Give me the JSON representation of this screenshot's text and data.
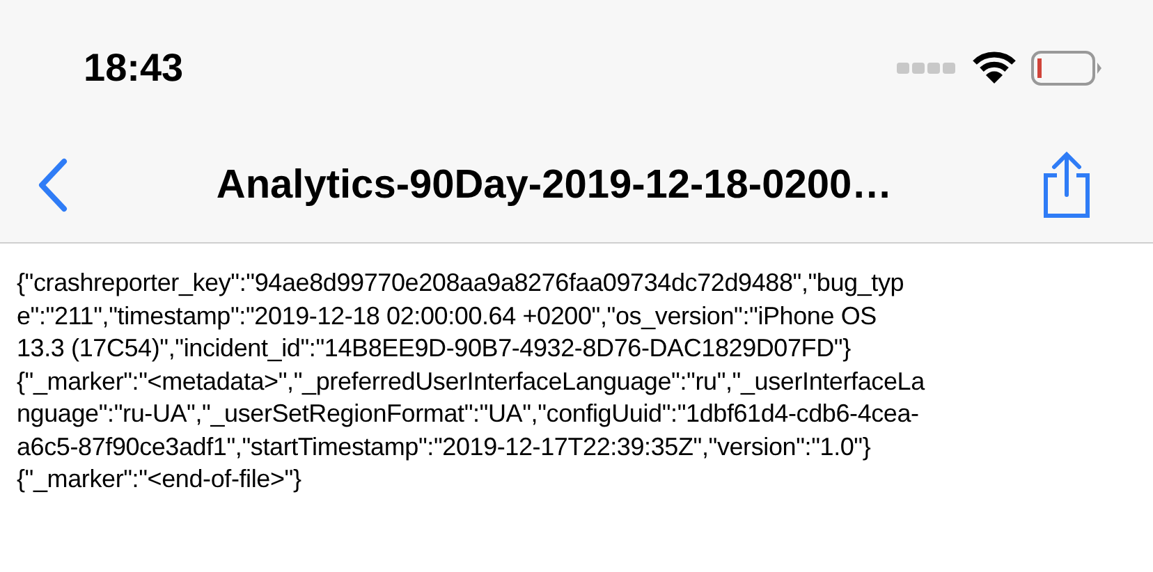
{
  "status_bar": {
    "time": "18:43"
  },
  "nav_bar": {
    "title": "Analytics-90Day-2019-12-18-0200…"
  },
  "document": {
    "lines": [
      "{\"crashreporter_key\":\"94ae8d99770e208aa9a8276faa09734dc72d9488\",\"bug_typ",
      "e\":\"211\",\"timestamp\":\"2019-12-18 02:00:00.64 +0200\",\"os_version\":\"iPhone OS",
      "13.3 (17C54)\",\"incident_id\":\"14B8EE9D-90B7-4932-8D76-DAC1829D07FD\"}",
      "{\"_marker\":\"<metadata>\",\"_preferredUserInterfaceLanguage\":\"ru\",\"_userInterfaceLa",
      "nguage\":\"ru-UA\",\"_userSetRegionFormat\":\"UA\",\"configUuid\":\"1dbf61d4-cdb6-4cea-",
      "a6c5-87f90ce3adf1\",\"startTimestamp\":\"2019-12-17T22:39:35Z\",\"version\":\"1.0\"}",
      "{\"_marker\":\"<end-of-file>\"}"
    ]
  }
}
